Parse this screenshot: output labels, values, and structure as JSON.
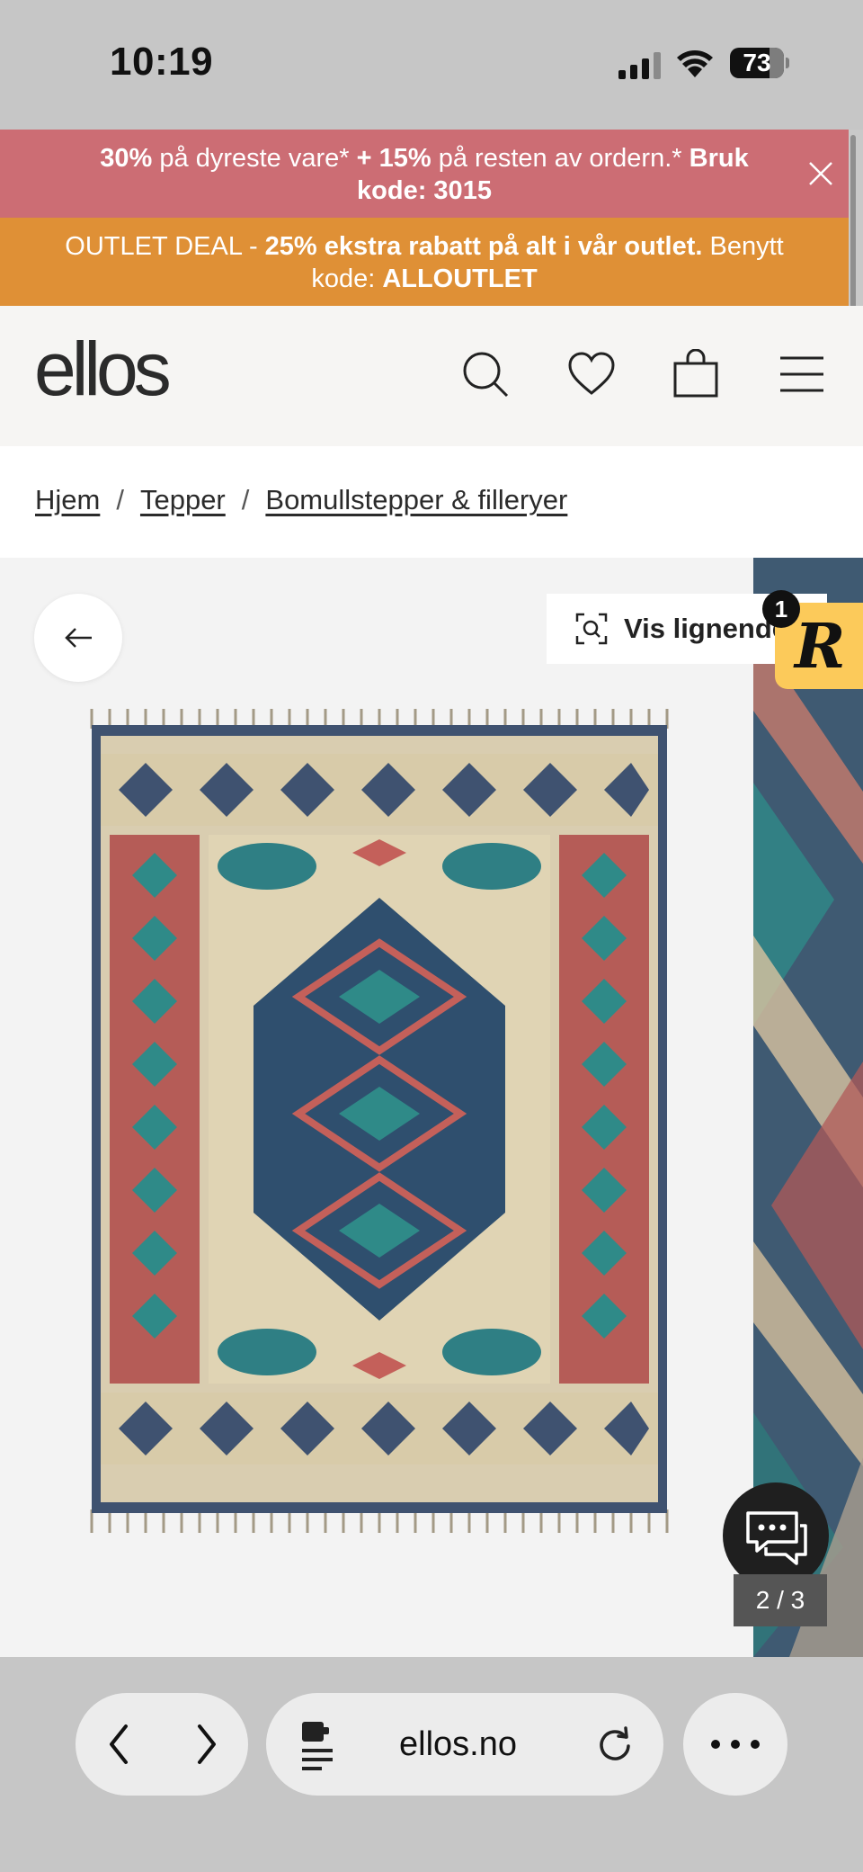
{
  "status_bar": {
    "time": "10:19",
    "battery": "73",
    "battery_level": 0.73
  },
  "promo_red": {
    "part1_bold": "30%",
    "part2": " på dyreste vare* ",
    "part3_bold": "+ 15%",
    "part4": " på resten av ordern.* ",
    "part5_bold": "Bruk kode: 3015"
  },
  "promo_orange": {
    "part1": "OUTLET DEAL - ",
    "part2_bold": "25% ekstra rabatt på alt i vår outlet.",
    "part3": " Benytt kode: ",
    "part4_bold": "ALLOUTLET"
  },
  "header": {
    "logo": "ellos"
  },
  "breadcrumb": {
    "items": [
      "Hjem",
      "Tepper",
      "Bomullstepper & filleryer"
    ],
    "separator": "/"
  },
  "gallery": {
    "similar_label": "Vis lignende",
    "r_badge_count": "1",
    "counter": "2 / 3"
  },
  "safari": {
    "url": "ellos.no"
  },
  "colors": {
    "promo_red": "#cc6d74",
    "promo_orange": "#df9036",
    "badge_yellow": "#fcca5a"
  }
}
